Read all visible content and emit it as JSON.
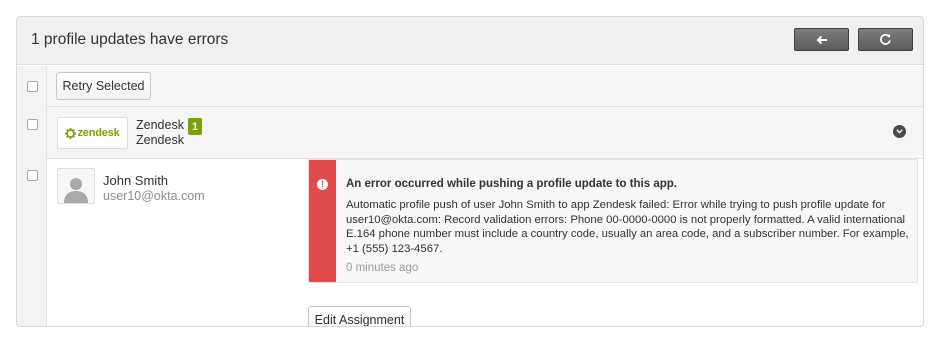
{
  "header": {
    "title": "1 profile updates have errors",
    "back_icon": "arrow-left-icon",
    "refresh_icon": "refresh-icon"
  },
  "toolbar": {
    "retry_label": "Retry Selected"
  },
  "app": {
    "logo_text": "zendesk",
    "logo_icon": "zendesk-gear-icon",
    "name": "Zendesk",
    "subtitle": "Zendesk",
    "error_count": "1",
    "expand_icon": "chevron-down-icon"
  },
  "user": {
    "name": "John Smith",
    "email": "user10@okta.com",
    "avatar_icon": "user-silhouette-icon"
  },
  "error": {
    "icon": "exclamation-icon",
    "title": "An error occurred while pushing a profile update to this app.",
    "message": "Automatic profile push of user John Smith to app Zendesk failed: Error while trying to push profile update for user10@okta.com: Record validation errors: Phone 00-0000-0000 is not properly formatted. A valid international E.164 phone number must include a country code, usually an area code, and a subscriber number. For example, +1 (555) 123-4567.",
    "time": "0 minutes ago"
  },
  "actions": {
    "edit_assignment_label": "Edit Assignment"
  },
  "colors": {
    "error_red": "#e14b4a",
    "zendesk_green": "#78a300",
    "header_bg": "#f0f0f0",
    "button_dark": "#6b6b6b"
  }
}
